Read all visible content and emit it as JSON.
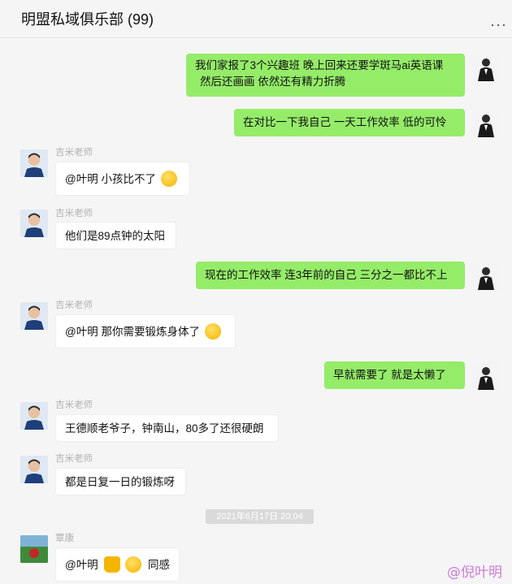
{
  "header": {
    "title": "明盟私域俱乐部 (99)",
    "more_icon": "···"
  },
  "messages": {
    "m1": {
      "line1": "我们家报了3个兴趣班   晚上回来还要学斑马ai英语课",
      "line2": "然后还画画    依然还有精力折腾"
    },
    "m2": {
      "text": "在对比一下我自己   一天工作效率 低的可怜"
    },
    "m3": {
      "sender": "吉米老师",
      "text": "@叶明 小孩比不了"
    },
    "m4": {
      "sender": "吉米老师",
      "text": "他们是89点钟的太阳"
    },
    "m5": {
      "text": "现在的工作效率 连3年前的自己 三分之一都比不上"
    },
    "m6": {
      "sender": "吉米老师",
      "text": "@叶明 那你需要锻炼身体了"
    },
    "m7": {
      "text": "早就需要了    就是太懒了"
    },
    "m8": {
      "sender": "吉米老师",
      "text": "王德顺老爷子，钟南山，80多了还很硬朗"
    },
    "m9": {
      "sender": "吉米老师",
      "text": "都是日复一日的锻炼呀"
    },
    "timestamp": "2021年6月17日 20:04",
    "m10": {
      "sender": "覃康",
      "text_before": "@叶明",
      "text_after": "同感"
    }
  },
  "watermark": "@倪叶明"
}
